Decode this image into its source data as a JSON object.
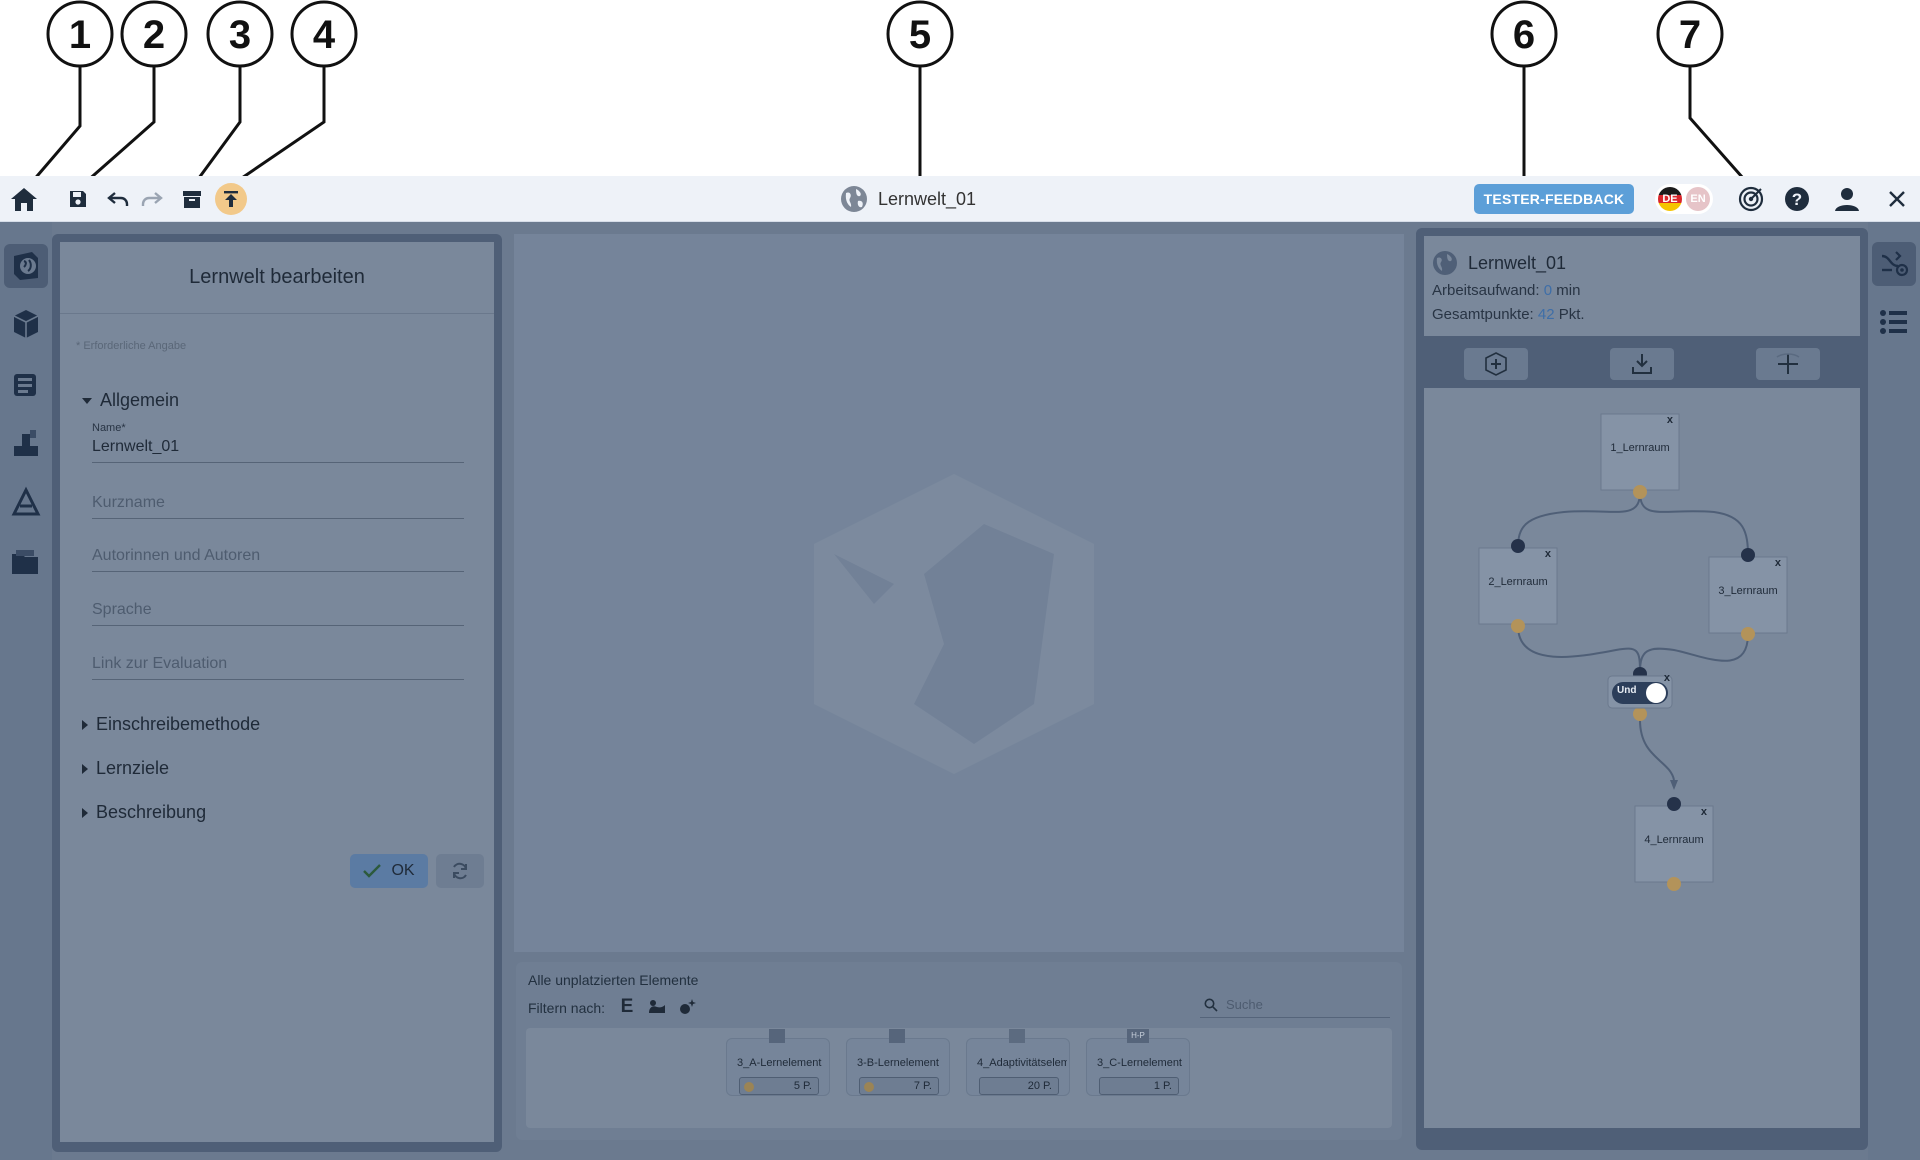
{
  "callouts": [
    "1",
    "2",
    "3",
    "4",
    "5",
    "6",
    "7"
  ],
  "toolbar": {
    "world_title": "Lernwelt_01",
    "tester_feedback_label": "TESTER-FEEDBACK",
    "lang_de": "DE",
    "lang_en": "EN"
  },
  "edit_panel": {
    "title": "Lernwelt bearbeiten",
    "required_note": "* Erforderliche Angabe",
    "section_general": "Allgemein",
    "name_label": "Name*",
    "name_value": "Lernwelt_01",
    "shortname_placeholder": "Kurzname",
    "authors_placeholder": "Autorinnen und Autoren",
    "language_placeholder": "Sprache",
    "evaluation_placeholder": "Link zur Evaluation",
    "section_enrolment": "Einschreibemethode",
    "section_goals": "Lernziele",
    "section_description": "Beschreibung",
    "ok_label": "OK"
  },
  "unplaced": {
    "title": "Alle unplatzierten Elemente",
    "filter_label": "Filtern nach:",
    "search_placeholder": "Suche",
    "filter_e": "E",
    "elements": [
      {
        "name": "3_A-Lernelement",
        "points": "5 P."
      },
      {
        "name": "3-B-Lernelement",
        "points": "7 P."
      },
      {
        "name": "4_Adaptivitätselement",
        "points": "20 P."
      },
      {
        "name": "3_C-Lernelement",
        "points": "1 P."
      }
    ],
    "element_badge_h5p": "H-P"
  },
  "right_panel": {
    "world_title": "Lernwelt_01",
    "workload_label": "Arbeitsaufwand:",
    "workload_value": "0",
    "workload_unit": "min",
    "points_label": "Gesamtpunkte:",
    "points_value": "42",
    "points_unit": "Pkt.",
    "nodes": [
      {
        "label": "1_Lernraum",
        "close": "x"
      },
      {
        "label": "2_Lernraum",
        "close": "x"
      },
      {
        "label": "3_Lernraum",
        "close": "x"
      },
      {
        "label": "4_Lernraum",
        "close": "x"
      }
    ],
    "condition_label": "Und",
    "condition_close": "x"
  },
  "colors": {
    "toolbar_bg": "#eef2f8",
    "tester_button": "#5c9fd8",
    "overlay": "#6b7a8f",
    "highlight_icon": "#f2c98a"
  }
}
